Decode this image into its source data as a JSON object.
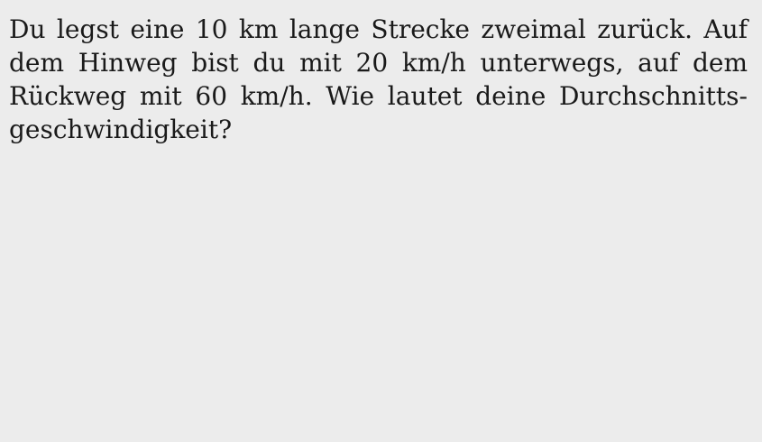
{
  "problem": {
    "lines": [
      "Du legst eine 10 km lange Strecke zweimal zurück. Auf",
      "dem Hinweg bist du mit 20 km/h unterwegs, auf dem",
      "Rückweg mit 60 km/h. Wie lautet deine Durchschnitts-",
      "geschwindigkeit?"
    ]
  }
}
